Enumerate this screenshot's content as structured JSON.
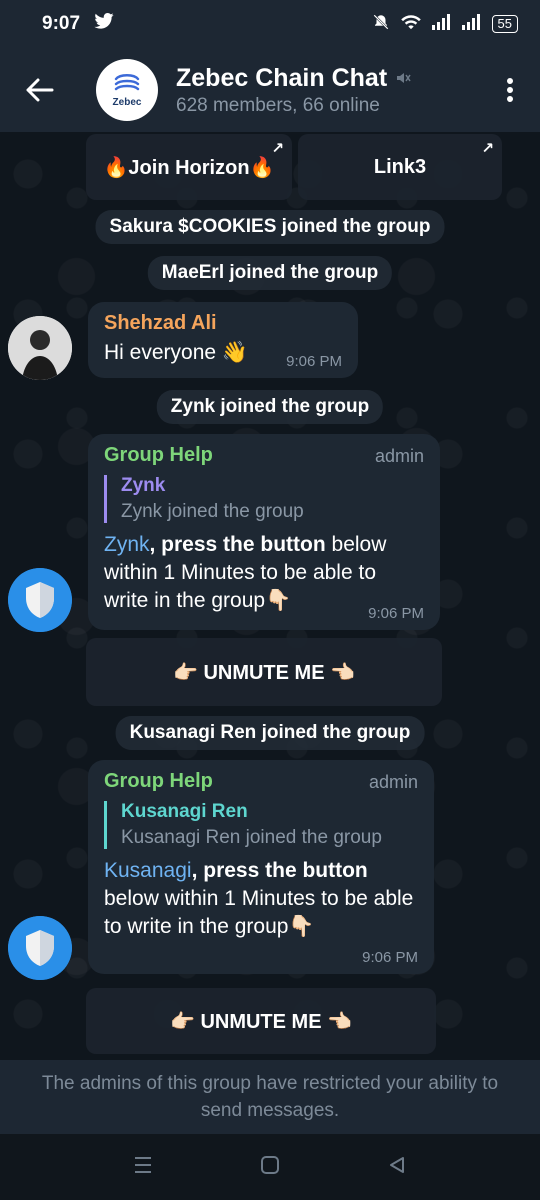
{
  "status_bar": {
    "time": "9:07",
    "battery": "55",
    "colors": {
      "bg": "#1d2733"
    }
  },
  "header": {
    "title": "Zebec Chain Chat",
    "subtitle": "628 members, 66 online",
    "logo_text": "Zebec",
    "muted_icon": "speaker-muted-icon"
  },
  "top_buttons": [
    {
      "label": "🔥Join Horizon🔥"
    },
    {
      "label": "Link3"
    }
  ],
  "service_messages": {
    "m1": "Sakura $COOKIES joined the group",
    "m2": "MaeErl joined the group",
    "m3": "Zynk joined the group",
    "m4": "Kusanagi Ren joined the group"
  },
  "message1": {
    "sender": "Shehzad Ali",
    "text": "Hi everyone 👋",
    "time": "9:06 PM",
    "sender_color": "#f5a55c"
  },
  "message2": {
    "sender": "Group Help",
    "tag": "admin",
    "reply_name": "Zynk",
    "reply_text": "Zynk joined the group",
    "mention": "Zynk",
    "bold": ", press the button",
    "rest": " below within 1 Minutes to be able to write in the group👇🏻",
    "time": "9:06 PM",
    "sender_color": "#7ed67a",
    "reply_color": "#9d8cf0"
  },
  "button1": {
    "label": "👉🏻 UNMUTE ME 👈🏻"
  },
  "message3": {
    "sender": "Group Help",
    "tag": "admin",
    "reply_name": "Kusanagi Ren",
    "reply_text": "Kusanagi Ren joined the group",
    "mention": "Kusanagi",
    "bold": ", press the button",
    "rest": " below within 1 Minutes to be able to write in the group👇🏻",
    "time": "9:06 PM",
    "sender_color": "#7ed67a",
    "reply_color": "#5ed6cf"
  },
  "button2": {
    "label": "👉🏻 UNMUTE ME 👈🏻"
  },
  "footer": {
    "text": "The admins of this group have restricted your ability to send messages."
  }
}
